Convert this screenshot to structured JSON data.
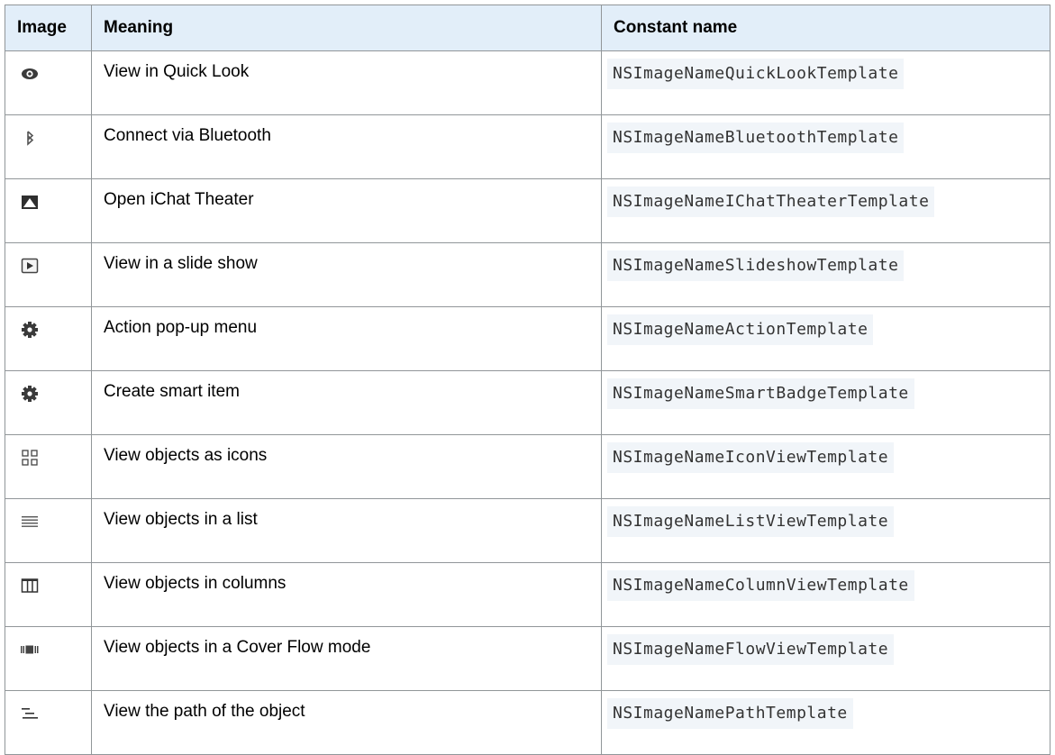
{
  "table": {
    "headers": [
      "Image",
      "Meaning",
      "Constant name"
    ],
    "rows": [
      {
        "icon": "quick-look-eye-icon",
        "meaning": "View in Quick Look",
        "constant": "NSImageNameQuickLookTemplate"
      },
      {
        "icon": "bluetooth-icon",
        "meaning": "Connect via Bluetooth",
        "constant": "NSImageNameBluetoothTemplate"
      },
      {
        "icon": "ichat-theater-icon",
        "meaning": "Open iChat Theater",
        "constant": "NSImageNameIChatTheaterTemplate"
      },
      {
        "icon": "slideshow-icon",
        "meaning": "View in a slide show",
        "constant": "NSImageNameSlideshowTemplate"
      },
      {
        "icon": "action-gear-icon",
        "meaning": "Action pop-up menu",
        "constant": "NSImageNameActionTemplate"
      },
      {
        "icon": "smart-badge-gear-icon",
        "meaning": "Create smart item",
        "constant": "NSImageNameSmartBadgeTemplate"
      },
      {
        "icon": "icon-view-icon",
        "meaning": "View objects as icons",
        "constant": "NSImageNameIconViewTemplate"
      },
      {
        "icon": "list-view-icon",
        "meaning": "View objects in a list",
        "constant": "NSImageNameListViewTemplate"
      },
      {
        "icon": "column-view-icon",
        "meaning": "View objects in columns",
        "constant": "NSImageNameColumnViewTemplate"
      },
      {
        "icon": "flow-view-icon",
        "meaning": "View objects in a Cover Flow mode",
        "constant": "NSImageNameFlowViewTemplate"
      },
      {
        "icon": "path-icon",
        "meaning": "View the path of the object",
        "constant": "NSImageNamePathTemplate"
      }
    ]
  },
  "colors": {
    "header_bg": "#e2eef9",
    "border": "#919699",
    "code_bg": "#f1f5f9"
  }
}
